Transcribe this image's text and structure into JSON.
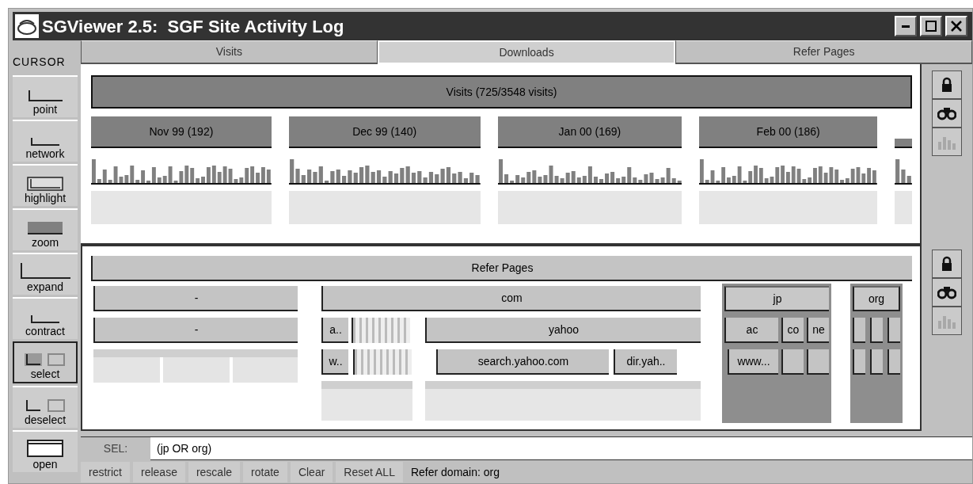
{
  "window": {
    "title": "SGViewer 2.5:  SGF Site Activity Log"
  },
  "cursor": {
    "label": "CURSOR",
    "tools": [
      {
        "kind": "point",
        "label": "point",
        "selected": false
      },
      {
        "kind": "network",
        "label": "network",
        "selected": false
      },
      {
        "kind": "highlight",
        "label": "highlight",
        "selected": false
      },
      {
        "kind": "zoom",
        "label": "zoom",
        "selected": false
      },
      {
        "kind": "expand",
        "label": "expand",
        "selected": false
      },
      {
        "kind": "contract",
        "label": "contract",
        "selected": false
      },
      {
        "kind": "select",
        "label": "select",
        "selected": true
      },
      {
        "kind": "deselect",
        "label": "deselect",
        "selected": false
      },
      {
        "kind": "open",
        "label": "open",
        "selected": false
      }
    ]
  },
  "tabs": [
    {
      "label": "Visits",
      "selected": false
    },
    {
      "label": "Downloads",
      "selected": true
    },
    {
      "label": "Refer Pages",
      "selected": false
    }
  ],
  "visits_panel": {
    "title": "Visits (725/3548 visits)",
    "months": [
      {
        "label": "Nov 99 (192)"
      },
      {
        "label": "Dec 99 (140)"
      },
      {
        "label": "Jan 00 (169)"
      },
      {
        "label": "Feb 00 (186)"
      },
      {
        "kind": "partial"
      }
    ]
  },
  "refer_panel": {
    "title": "Refer Pages",
    "domains": [
      {
        "label": "-",
        "selected": false,
        "children": [
          {
            "label": "-"
          }
        ]
      },
      {
        "label": "com",
        "selected": false,
        "children": [
          {
            "label": "a..",
            "children": [
              {
                "label": "w.."
              }
            ]
          },
          {
            "label": "yahoo",
            "children": [
              {
                "label": "search.yahoo.com"
              },
              {
                "label": "dir.yah.."
              }
            ]
          }
        ]
      },
      {
        "label": "jp",
        "selected": true,
        "children": [
          {
            "label": "ac",
            "children": [
              {
                "label": "www..."
              }
            ]
          },
          {
            "label": "co"
          },
          {
            "label": "ne"
          }
        ]
      },
      {
        "label": "org",
        "selected": true
      }
    ]
  },
  "side_tools": [
    {
      "kind": "lock",
      "disabled": false
    },
    {
      "kind": "binoculars",
      "disabled": false
    },
    {
      "kind": "chart",
      "disabled": true
    },
    {
      "kind": "lock",
      "disabled": false
    },
    {
      "kind": "binoculars",
      "disabled": false
    },
    {
      "kind": "chart",
      "disabled": true
    }
  ],
  "selection": {
    "label": "SEL:",
    "value": "(jp OR org)"
  },
  "buttons": [
    "restrict",
    "release",
    "rescale",
    "rotate",
    "Clear",
    "Reset ALL"
  ],
  "status": "Refer domain: org"
}
